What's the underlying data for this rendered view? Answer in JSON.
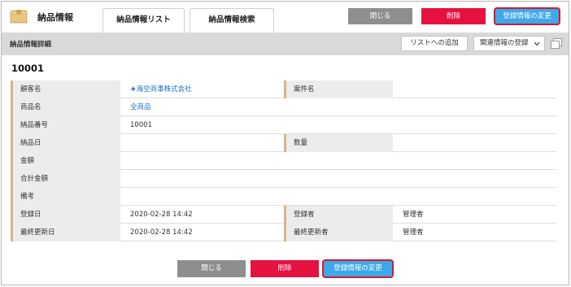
{
  "app": {
    "title": "納品情報"
  },
  "tabs": [
    {
      "label": "納品情報リスト"
    },
    {
      "label": "納品情報検索"
    }
  ],
  "header_buttons": {
    "close": "閉じる",
    "delete": "削除",
    "edit": "登録情報の変更"
  },
  "subheader": {
    "title": "納品情報詳細",
    "add_to_list": "リストへの追加",
    "related_select": "関連情報の登録"
  },
  "record_number": "10001",
  "fields": {
    "customer_label": "顧客名",
    "customer_value": "★海空商事株式会社",
    "project_label": "案件名",
    "project_value": "",
    "product_label": "商品名",
    "product_value": "全商品",
    "delivery_no_label": "納品番号",
    "delivery_no_value": "10001",
    "delivery_date_label": "納品日",
    "delivery_date_value": "",
    "quantity_label": "数量",
    "quantity_value": "",
    "amount_label": "金額",
    "amount_value": "",
    "total_label": "合計金額",
    "total_value": "",
    "notes_label": "備考",
    "notes_value": "",
    "created_label": "登録日",
    "created_value": "2020-02-28 14:42",
    "creator_label": "登録者",
    "creator_value": "管理者",
    "updated_label": "最終更新日",
    "updated_value": "2020-02-28 14:42",
    "updater_label": "最終更新者",
    "updater_value": "管理者"
  },
  "footer_buttons": {
    "close": "閉じる",
    "delete": "削除",
    "edit": "登録情報の変更"
  },
  "colors": {
    "gray_button": "#8e8e8e",
    "red_button": "#e5113f",
    "blue_button": "#3ea8ea",
    "label_bg": "#ececec",
    "label_accent": "#d6b487",
    "link": "#1a73c8"
  },
  "icons": [
    "box-icon",
    "chevron-down-icon",
    "duplicate-icon"
  ]
}
